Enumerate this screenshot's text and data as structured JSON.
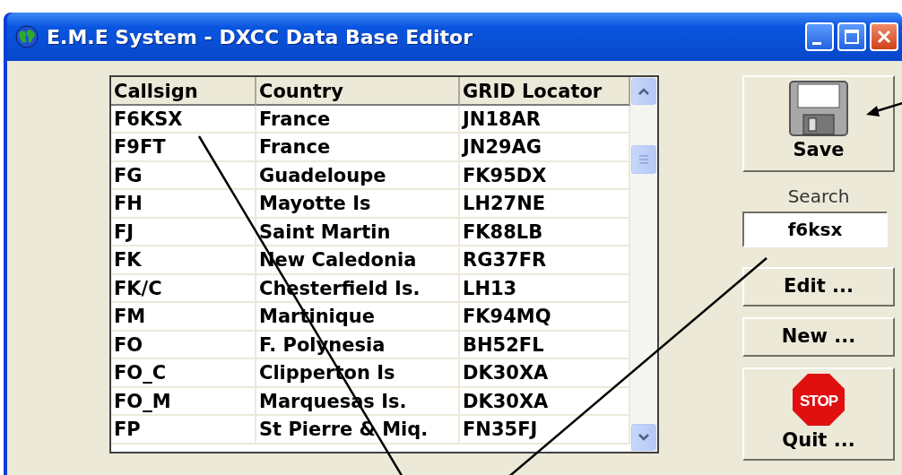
{
  "window": {
    "title": "E.M.E System - DXCC Data Base Editor"
  },
  "table": {
    "columns": [
      "Callsign",
      "Country",
      "GRID Locator"
    ],
    "rows": [
      [
        "F6KSX",
        "France",
        "JN18AR"
      ],
      [
        "F9FT",
        "France",
        "JN29AG"
      ],
      [
        "FG",
        "Guadeloupe",
        "FK95DX"
      ],
      [
        "FH",
        "Mayotte Is",
        "LH27NE"
      ],
      [
        "FJ",
        "Saint Martin",
        "FK88LB"
      ],
      [
        "FK",
        "New Caledonia",
        "RG37FR"
      ],
      [
        "FK/C",
        "Chesterfield Is.",
        "LH13"
      ],
      [
        "FM",
        "Martinique",
        "FK94MQ"
      ],
      [
        "FO",
        "F. Polynesia",
        "BH52FL"
      ],
      [
        "FO_C",
        "Clipperton Is",
        "DK30XA"
      ],
      [
        "FO_M",
        "Marquesas Is.",
        "DK30XA"
      ],
      [
        "FP",
        "St Pierre & Miq.",
        "FN35FJ"
      ]
    ]
  },
  "save_button": {
    "label": "Save"
  },
  "search": {
    "label": "Search",
    "value": "f6ksx"
  },
  "buttons": [
    {
      "kind": "text",
      "label": "Edit ..."
    },
    {
      "kind": "text",
      "label": "New ..."
    },
    {
      "kind": "stop",
      "label": "Quit ...",
      "icon_text": "STOP"
    }
  ]
}
